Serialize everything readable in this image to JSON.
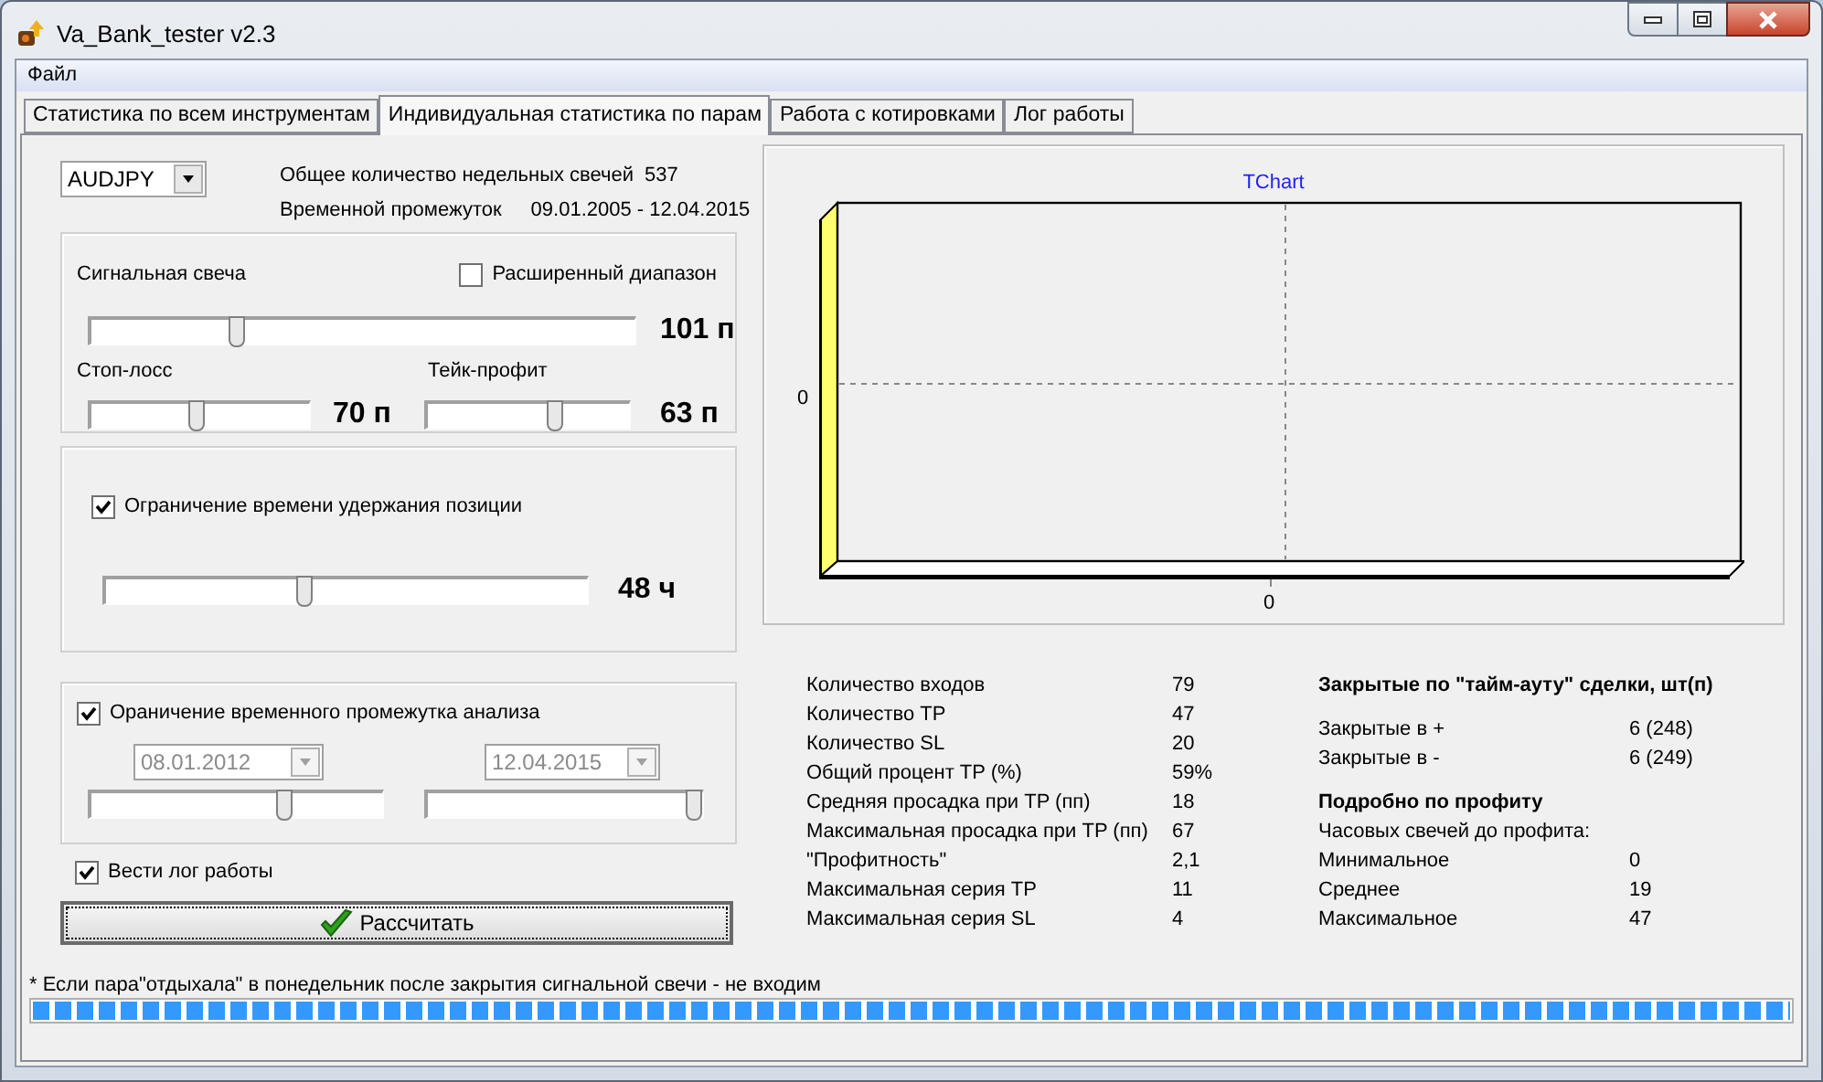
{
  "window": {
    "title": "Va_Bank_tester v2.3"
  },
  "menu": [
    "Файл"
  ],
  "tabs": [
    {
      "label": "Статистика по всем инструментам",
      "selected": false
    },
    {
      "label": "Индивидуальная статистика по парам",
      "selected": true
    },
    {
      "label": "Работа с котировками",
      "selected": false
    },
    {
      "label": "Лог работы",
      "selected": false
    }
  ],
  "pair_select": {
    "value": "AUDJPY"
  },
  "info": [
    {
      "label": "Общее количество недельных свечей",
      "value": "537"
    },
    {
      "label": "Временной промежуток",
      "value": "09.01.2005 - 12.04.2015"
    }
  ],
  "signal_group": {
    "label": "Сигнальная свеча",
    "extended_range": {
      "label": "Расширенный диапазон",
      "checked": false
    },
    "slider": {
      "level": 0.26,
      "reading": "101 п"
    },
    "stop_loss": {
      "label": "Стоп-лосс",
      "level": 0.48,
      "reading": "70 п"
    },
    "take_profit": {
      "label": "Тейк-профит",
      "level": 0.64,
      "reading": "63 п"
    }
  },
  "hold_group": {
    "checkbox": {
      "label": "Ограничение времени удержания позиции",
      "checked": true
    },
    "slider": {
      "level": 0.41,
      "reading": "48 ч"
    }
  },
  "period_group": {
    "checkbox": {
      "label": "Ораничение временного промежутка анализа",
      "checked": true
    },
    "start": {
      "value": "08.01.2012",
      "disabled": true,
      "level": 0.67
    },
    "end": {
      "value": "12.04.2015",
      "disabled": true,
      "level": 1
    }
  },
  "log_checkbox": {
    "label": "Вести лог работы",
    "checked": true
  },
  "calculate_button": "Рассчитать",
  "chart": {
    "title": "TChart",
    "y_tick": "0",
    "x_tick": "0"
  },
  "stats": [
    {
      "label": "Количество входов",
      "value": "79"
    },
    {
      "label": "Количество TP",
      "value": "47"
    },
    {
      "label": "Количество SL",
      "value": "20"
    },
    {
      "label": "Общий процент TP   (%)",
      "value": "59%"
    },
    {
      "label": "Средняя просадка при TP (пп)",
      "value": "18"
    },
    {
      "label": "Максимальная просадка при TP (пп)",
      "value": "67"
    },
    {
      "label": "\"Профитность\"",
      "value": "2,1"
    },
    {
      "label": "Максимальная серия TP",
      "value": "11"
    },
    {
      "label": "Максимальная серия SL",
      "value": "4"
    }
  ],
  "timeout": {
    "title": "Закрытые по \"тайм-ауту\" сделки, шт(п)",
    "rows": [
      {
        "label": "Закрытые в +",
        "value": "6 (248)"
      },
      {
        "label": "Закрытые в -",
        "value": "6 (249)"
      }
    ]
  },
  "profit": {
    "title": "Подробно по профиту",
    "subtitle": "Часовых свечей до профита:",
    "rows": [
      {
        "label": "Минимальное",
        "value": "0"
      },
      {
        "label": "Среднее",
        "value": "19"
      },
      {
        "label": "Максимальное",
        "value": "47"
      }
    ]
  },
  "footnote": "* Если пара\"отдыхала\" в понедельник после закрытия сигнальной свечи - не входим",
  "progress": {
    "level": 1
  }
}
